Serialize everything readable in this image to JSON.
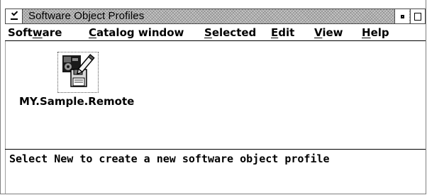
{
  "window": {
    "title": "Software Object Profiles"
  },
  "menubar": {
    "items": [
      {
        "label": "Software",
        "mnemonic": "w"
      },
      {
        "label": "Catalog window",
        "mnemonic": "C"
      },
      {
        "label": "Selected",
        "mnemonic": "S"
      },
      {
        "label": "Edit",
        "mnemonic": "E"
      },
      {
        "label": "View",
        "mnemonic": "V"
      },
      {
        "label": "Help",
        "mnemonic": "H"
      }
    ]
  },
  "objects": [
    {
      "label": "MY.Sample.Remote",
      "icon": "software-profile-icon"
    }
  ],
  "status": {
    "message": "Select New to create a new software object profile"
  }
}
